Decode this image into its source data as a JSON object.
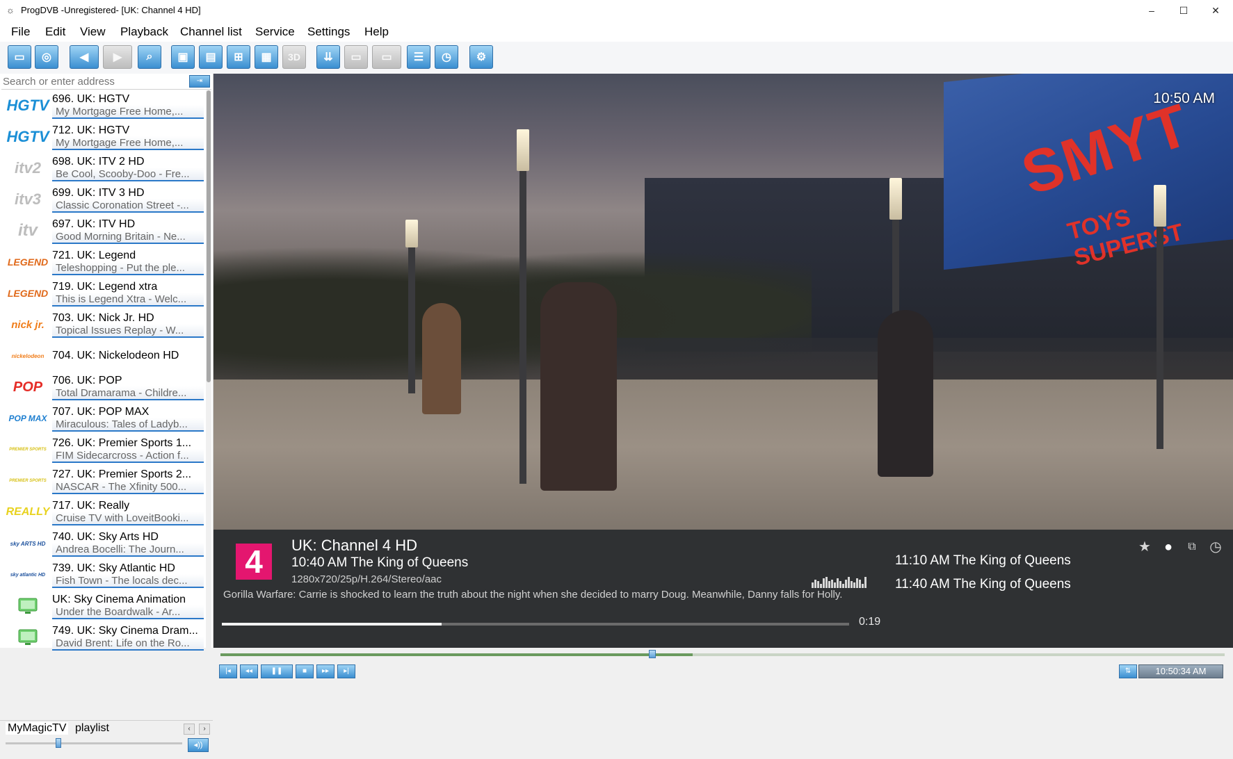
{
  "window": {
    "title": "ProgDVB -Unregistered-  [UK: Channel 4 HD]",
    "minimize": "–",
    "maximize": "☐",
    "close": "✕"
  },
  "menu": [
    "File",
    "Edit",
    "View",
    "Playback",
    "Channel list",
    "Service",
    "Settings",
    "Help"
  ],
  "search": {
    "placeholder": "Search or enter address"
  },
  "channels": [
    {
      "name": "696. UK: HGTV",
      "sub": "My Mortgage Free Home,...",
      "logo": "HGTV",
      "logo_color": "#1b8fd6"
    },
    {
      "name": "712. UK: HGTV",
      "sub": "My Mortgage Free Home,...",
      "logo": "HGTV",
      "logo_color": "#1b8fd6"
    },
    {
      "name": "698. UK: ITV 2 HD",
      "sub": "Be Cool, Scooby-Doo - Fre...",
      "logo": "itv2",
      "logo_color": "#bdbdbd"
    },
    {
      "name": "699. UK: ITV 3 HD",
      "sub": "Classic Coronation Street -...",
      "logo": "itv3",
      "logo_color": "#bdbdbd"
    },
    {
      "name": "697. UK: ITV HD",
      "sub": "Good Morning Britain - Ne...",
      "logo": "itv",
      "logo_color": "#bdbdbd"
    },
    {
      "name": "721. UK: Legend",
      "sub": "Teleshopping - Put the ple...",
      "logo": "LEGEND",
      "logo_color": "#e0691a"
    },
    {
      "name": "719. UK: Legend xtra",
      "sub": "This is Legend Xtra - Welc...",
      "logo": "LEGEND",
      "logo_color": "#e0691a"
    },
    {
      "name": "703. UK: Nick Jr. HD",
      "sub": "Topical Issues Replay - W...",
      "logo": "nick jr.",
      "logo_color": "#f07d1a"
    },
    {
      "name": "704. UK: Nickelodeon HD",
      "sub": "",
      "logo": "nickelodeon",
      "logo_color": "#f07d1a"
    },
    {
      "name": "706. UK: POP",
      "sub": "Total Dramarama - Childre...",
      "logo": "POP",
      "logo_color": "#e52d27"
    },
    {
      "name": "707. UK: POP MAX",
      "sub": "Miraculous: Tales of Ladyb...",
      "logo": "POP MAX",
      "logo_color": "#1e7fd0"
    },
    {
      "name": "726. UK: Premier Sports 1...",
      "sub": "FIM Sidecarcross - Action f...",
      "logo": "PREMIER SPORTS",
      "logo_color": "#d8c21a"
    },
    {
      "name": "727. UK: Premier Sports 2...",
      "sub": "NASCAR - The Xfinity 500...",
      "logo": "PREMIER SPORTS",
      "logo_color": "#d8c21a"
    },
    {
      "name": "717. UK: Really",
      "sub": "Cruise TV with LoveitBooki...",
      "logo": "REALLY",
      "logo_color": "#e8d21e"
    },
    {
      "name": "740. UK: Sky Arts HD",
      "sub": "Andrea Bocelli: The Journ...",
      "logo": "sky ARTS HD",
      "logo_color": "#1a4f9c"
    },
    {
      "name": "739. UK: Sky Atlantic HD",
      "sub": "Fish Town - The locals dec...",
      "logo": "sky atlantic HD",
      "logo_color": "#1a4f9c"
    },
    {
      "name": "UK: Sky Cinema Animation",
      "sub": "Under the Boardwalk - Ar...",
      "logo": "tv-icon",
      "logo_color": "#4caf50"
    },
    {
      "name": "749. UK: Sky Cinema Dram...",
      "sub": "David Brent: Life on the Ro...",
      "logo": "tv-icon",
      "logo_color": "#4caf50"
    }
  ],
  "tabs": [
    "MyMagicTV",
    "playlist"
  ],
  "video": {
    "clock": "10:50 AM",
    "billboard_text": "SMYT",
    "billboard_sub": "TOYS SUPERST"
  },
  "osd": {
    "logo": "4",
    "logo_color": "#e4166f",
    "channel": "UK: Channel 4 HD",
    "now": "10:40 AM The King of Queens",
    "tech": "1280x720/25p/H.264/Stereo/aac",
    "description": "Gorilla Warfare: Carrie is shocked to learn the truth about the night when she decided to marry Doug. Meanwhile, Danny falls for Holly.",
    "elapsed": "0:19",
    "progress": 0.35,
    "next": [
      "11:10 AM The King of Queens",
      "11:40 AM The King of Queens"
    ]
  },
  "seek": {
    "position": 0.43,
    "buffer": 0.47
  },
  "status": {
    "clock": "10:50:34 AM"
  }
}
